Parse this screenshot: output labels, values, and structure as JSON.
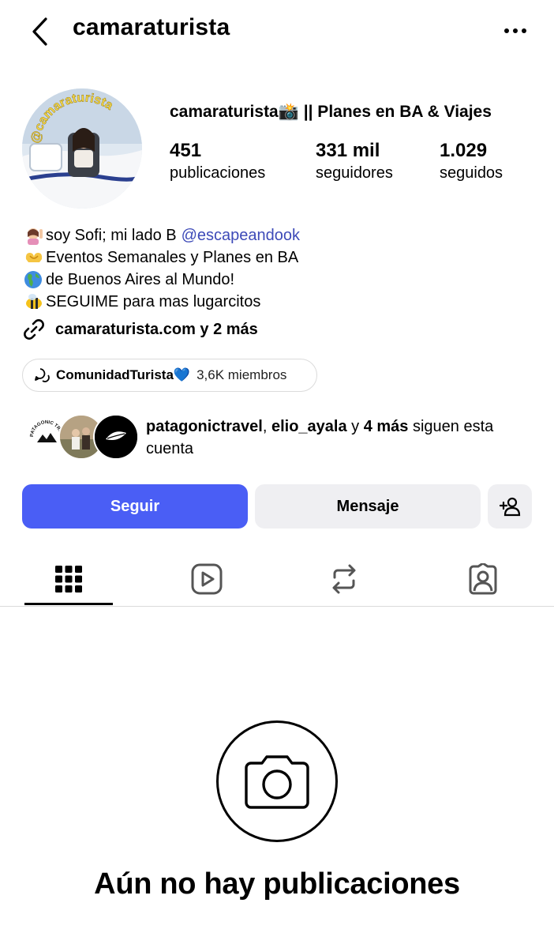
{
  "header": {
    "username": "camaraturista",
    "back_icon": "chevron-left-icon",
    "more_icon": "more-horizontal-icon"
  },
  "profile": {
    "display_name": "camaraturista📸 || Planes en BA & Viajes",
    "stats": {
      "posts_value": "451",
      "posts_label": "publicaciones",
      "followers_value": "331 mil",
      "followers_label": "seguidores",
      "following_value": "1.029",
      "following_label": "seguidos"
    },
    "avatar_badge_text": "@camaraturista",
    "bio": {
      "line1_text": "soy Sofi; mi lado B",
      "line1_mention": "@escapeandook",
      "line2_text": "Eventos Semanales y Planes en BA",
      "line3_text": "de Buenos Aires al Mundo!",
      "line4_text": "SEGUIME para mas lugarcitos"
    },
    "link_text": "camaraturista.com y 2 más",
    "community": {
      "name": "ComunidadTurista💙",
      "members": "3,6K miembros"
    },
    "mutuals": {
      "name1": "patagonictravel",
      "sep": ", ",
      "name2": "elio_ayala",
      "and": " y ",
      "more": "4 más",
      "suffix": " siguen esta cuenta",
      "first_avatar_text": "PATAGONIC TRAVEL"
    }
  },
  "actions": {
    "follow_label": "Seguir",
    "message_label": "Mensaje"
  },
  "tabs": [
    "grid-icon",
    "reels-icon",
    "reposts-icon",
    "tagged-icon"
  ],
  "empty_state": {
    "title": "Aún no hay publicaciones"
  },
  "colors": {
    "accent": "#4a5ef5",
    "mention": "#3d4ab8",
    "secondary_button": "#efeff2"
  }
}
